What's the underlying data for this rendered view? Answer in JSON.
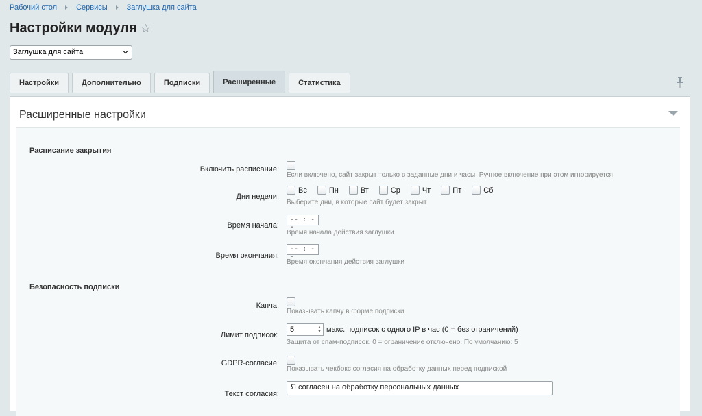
{
  "breadcrumb": [
    "Рабочий стол",
    "Сервисы",
    "Заглушка для сайта"
  ],
  "page": {
    "title": "Настройки модуля",
    "module_select": "Заглушка для сайта"
  },
  "tabs": [
    {
      "label": "Настройки",
      "active": false
    },
    {
      "label": "Дополнительно",
      "active": false
    },
    {
      "label": "Подписки",
      "active": false
    },
    {
      "label": "Расширенные",
      "active": true
    },
    {
      "label": "Статистика",
      "active": false
    }
  ],
  "panel": {
    "title": "Расширенные настройки"
  },
  "schedule": {
    "title": "Расписание закрытия",
    "enable": {
      "label": "Включить расписание:",
      "hint": "Если включено, сайт закрыт только в заданные дни и часы. Ручное включение при этом игнорируется"
    },
    "days": {
      "label": "Дни недели:",
      "items": [
        "Вс",
        "Пн",
        "Вт",
        "Ср",
        "Чт",
        "Пт",
        "Сб"
      ],
      "hint": "Выберите дни, в которые сайт будет закрыт"
    },
    "start": {
      "label": "Время начала:",
      "value": "-- : --",
      "hint": "Время начала действия заглушки"
    },
    "end": {
      "label": "Время окончания:",
      "value": "-- : --",
      "hint": "Время окончания действия заглушки"
    }
  },
  "security": {
    "title": "Безопасность подписки",
    "captcha": {
      "label": "Капча:",
      "hint": "Показывать капчу в форме подписки"
    },
    "limit": {
      "label": "Лимит подписок:",
      "value": "5",
      "suffix": "макс. подписок с одного IP в час (0 = без ограничений)",
      "hint": "Защита от спам-подписок. 0 = ограничение отключено. По умолчанию: 5"
    },
    "gdpr": {
      "label": "GDPR-согласие:",
      "hint": "Показывать чекбокс согласия на обработку данных перед подпиской"
    },
    "consent": {
      "label": "Текст согласия:",
      "value": "Я согласен на обработку персональных данных"
    }
  }
}
